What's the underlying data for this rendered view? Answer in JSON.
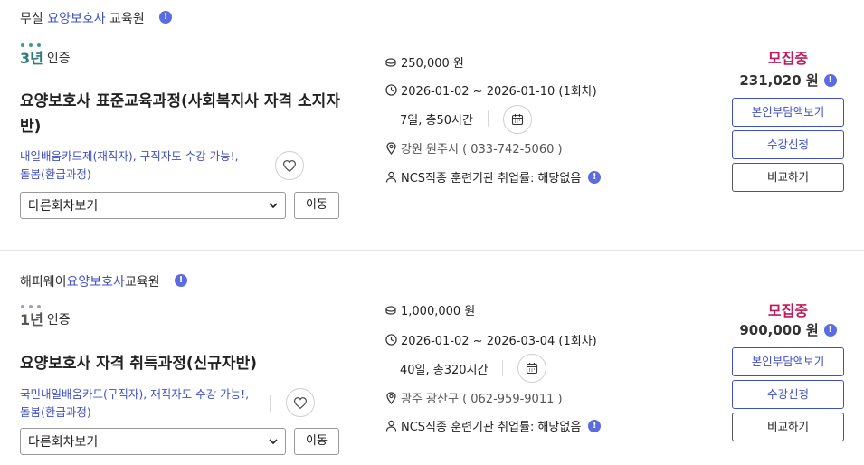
{
  "colors": {
    "accent": "#3f4fc6",
    "status": "#c2185b",
    "info": "#5b6be0",
    "cert_green": "#3f9b8e"
  },
  "courses": [
    {
      "institution_prefix": "무실 ",
      "institution_highlight": "요양보호사",
      "institution_suffix": " 교육원",
      "cert_years": "3년",
      "cert_label": "인증",
      "title": "요양보호사 표준교육과정(사회복지사 자격 소지자반)",
      "support_line1": "내일배움카드제(재직자), 구직자도 수강 가능!,",
      "support_line2": "돌봄(환급과정)",
      "round_select": "다른회차보기",
      "move_label": "이동",
      "tuition": "250,000 원",
      "period": "2026-01-02 ~ 2026-01-10 (1회차)",
      "duration": "7일, 총50시간",
      "location": "강원 원주시 ( 033-742-5060 )",
      "ncs": "NCS직종 훈련기관 취업률: 해당없음",
      "status": "모집중",
      "self_pay": "231,020 원",
      "btn_self_pay": "본인부담액보기",
      "btn_apply": "수강신청",
      "btn_compare": "비교하기",
      "icons": [
        "info-icon",
        "coin-icon",
        "clock-icon",
        "calendar-icon",
        "location-pin-icon",
        "person-icon",
        "heart-icon",
        "chevron-down-icon"
      ]
    },
    {
      "institution_prefix": "해피웨이",
      "institution_highlight": "요양보호사",
      "institution_suffix": "교육원",
      "cert_years": "1년",
      "cert_label": "인증",
      "title": "요양보호사 자격 취득과정(신규자반)",
      "support_line1": "국민내일배움카드(구직자), 재직자도 수강 가능!,",
      "support_line2": "돌봄(환급과정)",
      "round_select": "다른회차보기",
      "move_label": "이동",
      "tuition": "1,000,000 원",
      "period": "2026-01-02 ~ 2026-03-04 (1회차)",
      "duration": "40일, 총320시간",
      "location": "광주 광산구 ( 062-959-9011 )",
      "ncs": "NCS직종 훈련기관 취업률: 해당없음",
      "status": "모집중",
      "self_pay": "900,000 원",
      "btn_self_pay": "본인부담액보기",
      "btn_apply": "수강신청",
      "btn_compare": "비교하기"
    }
  ]
}
